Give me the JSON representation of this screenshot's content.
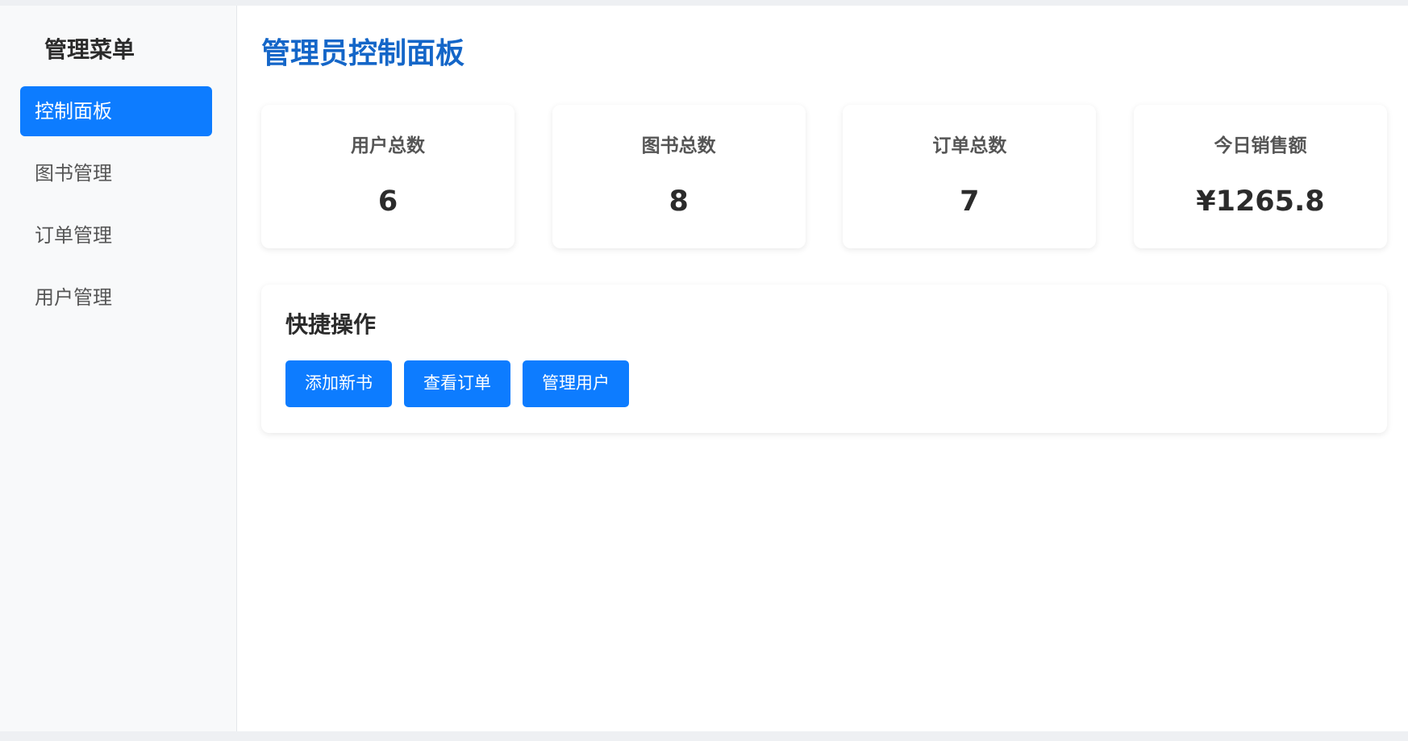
{
  "sidebar": {
    "title": "管理菜单",
    "items": [
      {
        "label": "控制面板",
        "active": true
      },
      {
        "label": "图书管理",
        "active": false
      },
      {
        "label": "订单管理",
        "active": false
      },
      {
        "label": "用户管理",
        "active": false
      }
    ]
  },
  "main": {
    "title": "管理员控制面板",
    "stats": [
      {
        "label": "用户总数",
        "value": "6"
      },
      {
        "label": "图书总数",
        "value": "8"
      },
      {
        "label": "订单总数",
        "value": "7"
      },
      {
        "label": "今日销售额",
        "value": "¥1265.8"
      }
    ],
    "quick_actions": {
      "title": "快捷操作",
      "buttons": [
        {
          "label": "添加新书"
        },
        {
          "label": "查看订单"
        },
        {
          "label": "管理用户"
        }
      ]
    }
  },
  "colors": {
    "accent": "#0d7cff",
    "title": "#1466c8",
    "sidebar_bg": "#f8f9fa"
  }
}
